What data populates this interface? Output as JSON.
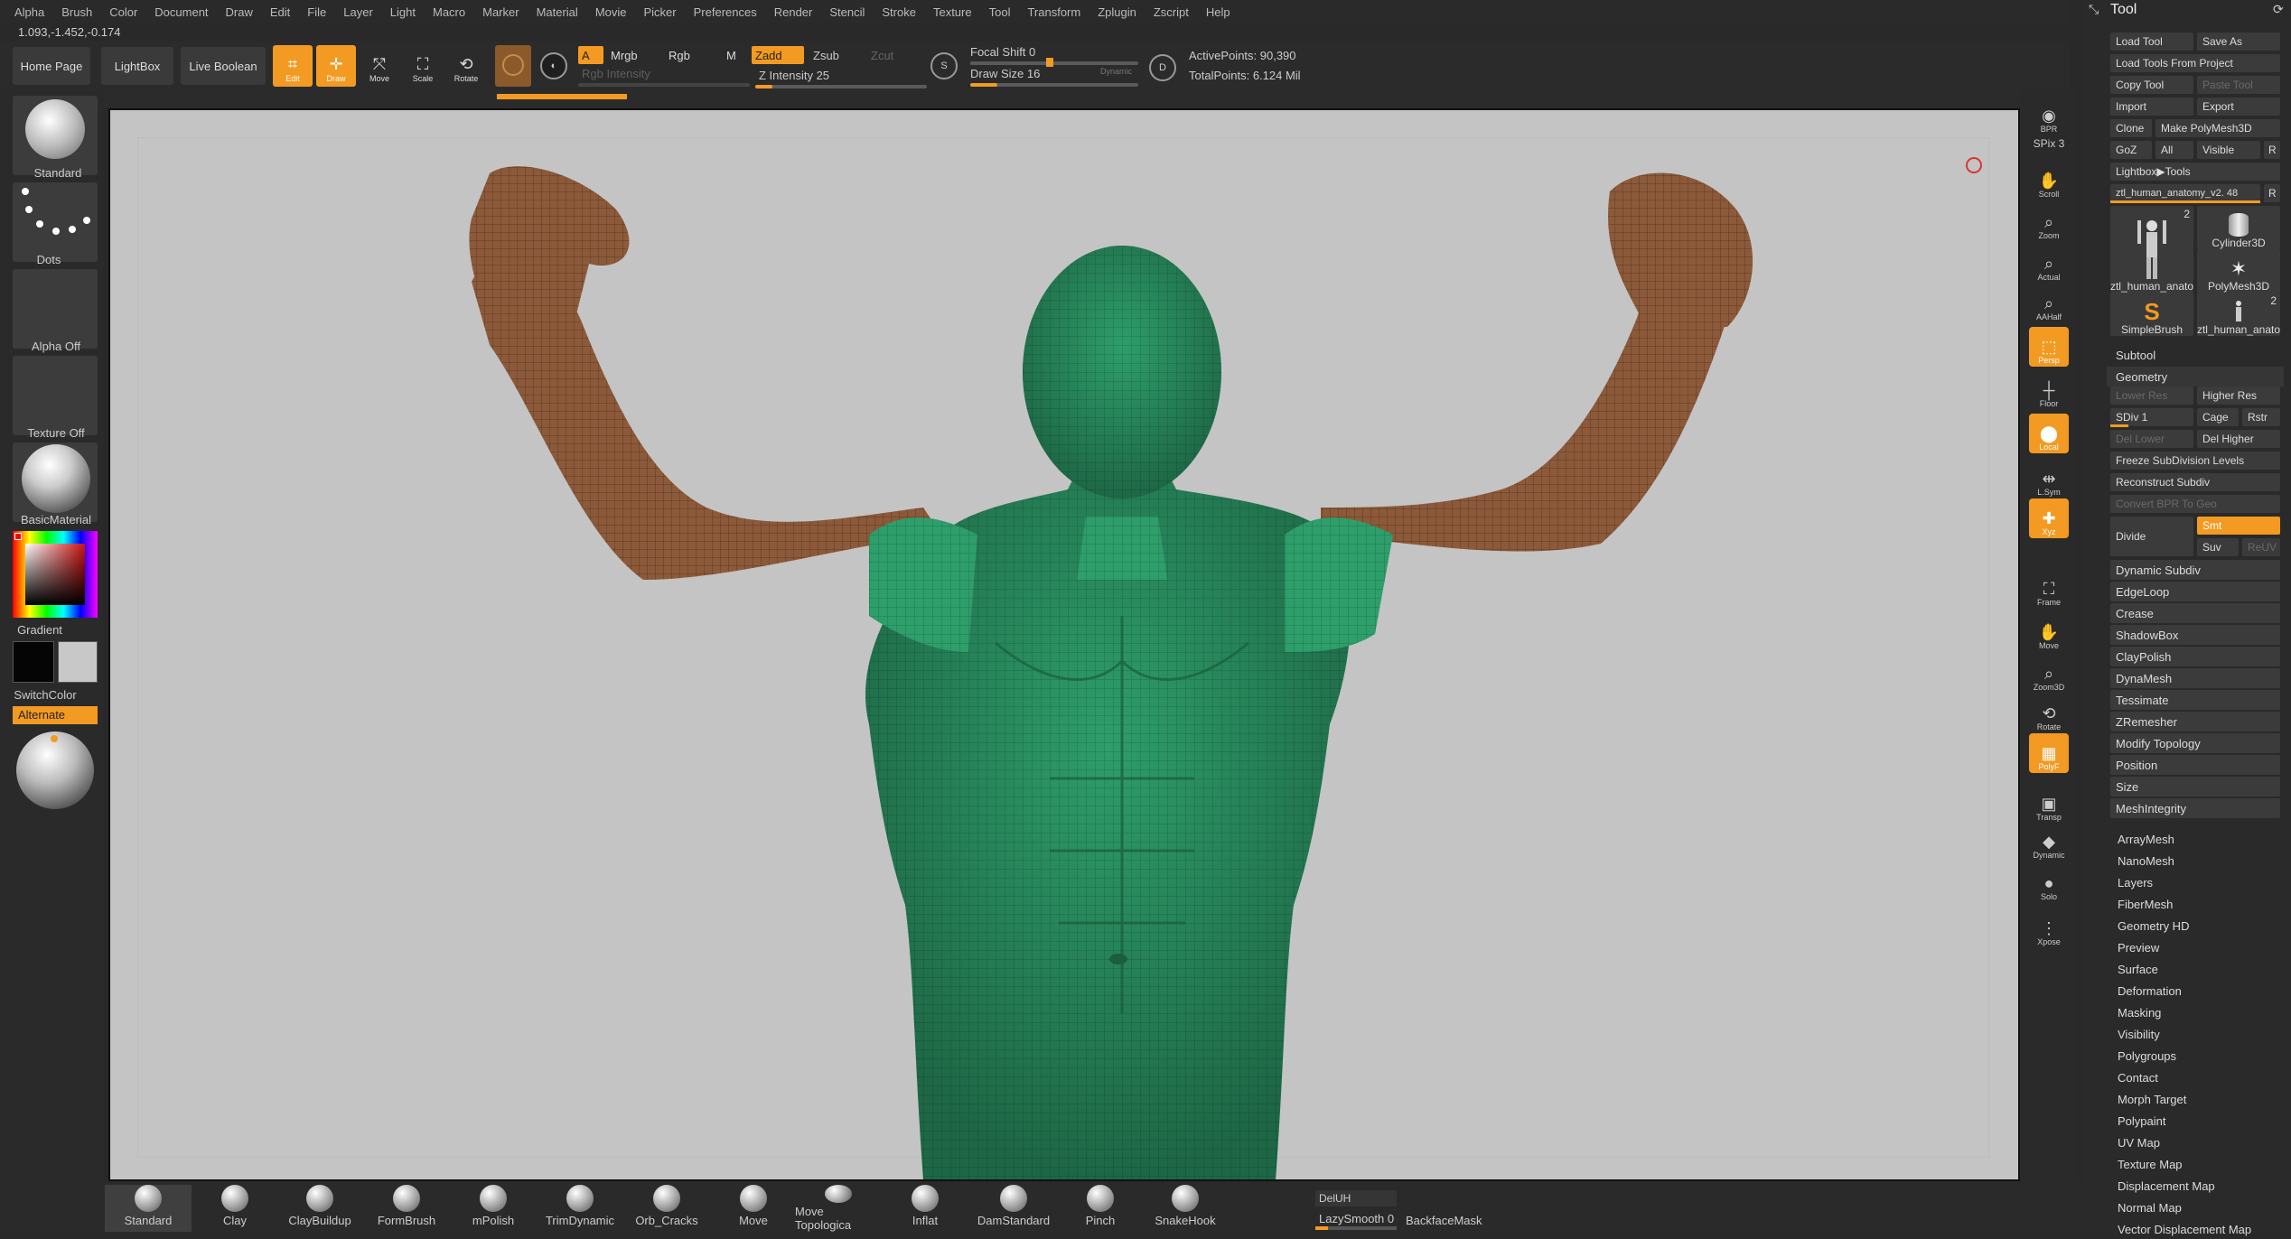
{
  "menu": [
    "Alpha",
    "Brush",
    "Color",
    "Document",
    "Draw",
    "Edit",
    "File",
    "Layer",
    "Light",
    "Macro",
    "Marker",
    "Material",
    "Movie",
    "Picker",
    "Preferences",
    "Render",
    "Stencil",
    "Stroke",
    "Texture",
    "Tool",
    "Transform",
    "Zplugin",
    "Zscript",
    "Help"
  ],
  "coords": "1.093,-1.452,-0.174",
  "top": {
    "home_page": "Home Page",
    "lightbox": "LightBox",
    "live_boolean": "Live Boolean",
    "edit": "Edit",
    "draw": "Draw",
    "move": "Move",
    "scale": "Scale",
    "rotate": "Rotate",
    "a": "A",
    "mrgb": "Mrgb",
    "rgb": "Rgb",
    "m": "M",
    "rgb_intensity": "Rgb Intensity",
    "zadd": "Zadd",
    "zsub": "Zsub",
    "zcut": "Zcut",
    "z_intensity": "Z Intensity 25",
    "z_intensity_level": 0.25,
    "s": "S",
    "focal_shift": "Focal Shift 0",
    "draw_size": "Draw Size 16",
    "dynamic": "Dynamic",
    "d": "D",
    "active_points": "ActivePoints: 90,390",
    "total_points": "TotalPoints: 6.124 Mil"
  },
  "left": {
    "standard": "Standard",
    "dots": "Dots",
    "alpha_off": "Alpha Off",
    "texture_off": "Texture Off",
    "basic_material": "BasicMaterial",
    "gradient": "Gradient",
    "switch_color": "SwitchColor",
    "alternate": "Alternate"
  },
  "right_strip": [
    {
      "label": "BPR",
      "icon": "bpr-icon",
      "on": false
    },
    {
      "label": "SPix 3",
      "icon": "",
      "on": false
    },
    {
      "label": "Scroll",
      "icon": "scroll-icon",
      "on": false
    },
    {
      "label": "Zoom",
      "icon": "zoom-icon",
      "on": false
    },
    {
      "label": "Actual",
      "icon": "actual-icon",
      "on": false
    },
    {
      "label": "AAHalf",
      "icon": "aahalf-icon",
      "on": false
    },
    {
      "label": "Persp",
      "icon": "persp-icon",
      "on": true
    },
    {
      "label": "Floor",
      "icon": "floor-icon",
      "on": false
    },
    {
      "label": "Local",
      "icon": "local-icon",
      "on": true
    },
    {
      "label": "L.Sym",
      "icon": "lsym-icon",
      "on": false
    },
    {
      "label": "Xyz",
      "icon": "xyz-icon",
      "on": true
    },
    {
      "label": "Frame",
      "icon": "frame-icon",
      "on": false
    },
    {
      "label": "Move",
      "icon": "move-icon",
      "on": false
    },
    {
      "label": "Zoom3D",
      "icon": "zoom3d-icon",
      "on": false
    },
    {
      "label": "Rotate",
      "icon": "rotate-icon",
      "on": false
    },
    {
      "label": "PolyF",
      "icon": "polyf-icon",
      "on": true
    },
    {
      "label": "Transp",
      "icon": "transp-icon",
      "on": false
    },
    {
      "label": "Dynamic",
      "icon": "dynamic-icon",
      "on": false
    },
    {
      "label": "Solo",
      "icon": "solo-icon",
      "on": false
    },
    {
      "label": "Xpose",
      "icon": "xpose-icon",
      "on": false
    }
  ],
  "bottom": {
    "brushes": [
      "Standard",
      "Clay",
      "ClayBuildup",
      "FormBrush",
      "mPolish",
      "TrimDynamic",
      "Orb_Cracks",
      "Move",
      "Move Topologica",
      "Inflat",
      "DamStandard",
      "Pinch",
      "SnakeHook"
    ],
    "deluh": "DelUH",
    "lazy_smooth": "LazySmooth 0",
    "backface_mask": "BackfaceMask"
  },
  "tool_panel": {
    "title": "Tool",
    "load_tool": "Load Tool",
    "save_as": "Save As",
    "load_from_project": "Load Tools From Project",
    "copy_tool": "Copy Tool",
    "paste_tool": "Paste Tool",
    "import": "Import",
    "export": "Export",
    "clone": "Clone",
    "make_polymesh": "Make PolyMesh3D",
    "goz": "GoZ",
    "all": "All",
    "visible": "Visible",
    "r": "R",
    "lightbox_tools": "Lightbox▶Tools",
    "current_tool": "ztl_human_anatomy_v2. 48",
    "thumbs": [
      {
        "name": "ztl_human_anato",
        "count": "2"
      },
      {
        "name": "Cylinder3D",
        "count": ""
      },
      {
        "name": "PolyMesh3D",
        "count": ""
      },
      {
        "name": "SimpleBrush",
        "count": ""
      },
      {
        "name": "ztl_human_anato",
        "count": "2"
      }
    ],
    "subtool": "Subtool",
    "geometry": "Geometry",
    "lower_res": "Lower Res",
    "higher_res": "Higher Res",
    "sdiv": "SDiv 1",
    "cage": "Cage",
    "rstr": "Rstr",
    "del_lower": "Del Lower",
    "del_higher": "Del Higher",
    "freeze": "Freeze SubDivision Levels",
    "reconstruct": "Reconstruct Subdiv",
    "convert_bpr": "Convert BPR To Geo",
    "divide": "Divide",
    "smt": "Smt",
    "suv": "Suv",
    "reuv": "ReUV",
    "geo_items": [
      "Dynamic Subdiv",
      "EdgeLoop",
      "Crease",
      "ShadowBox",
      "ClayPolish",
      "DynaMesh",
      "Tessimate",
      "ZRemesher",
      "Modify Topology",
      "Position",
      "Size",
      "MeshIntegrity"
    ],
    "sections": [
      "ArrayMesh",
      "NanoMesh",
      "Layers",
      "FiberMesh",
      "Geometry HD",
      "Preview",
      "Surface",
      "Deformation",
      "Masking",
      "Visibility",
      "Polygroups",
      "Contact",
      "Morph Target",
      "Polypaint",
      "UV Map",
      "Texture Map",
      "Displacement Map",
      "Normal Map",
      "Vector Displacement Map"
    ]
  },
  "colors": {
    "accent": "#f39a22",
    "skin": "#8c5a3a",
    "mesh_green": "#2fa36e",
    "viewport": "#c4c4c4"
  }
}
